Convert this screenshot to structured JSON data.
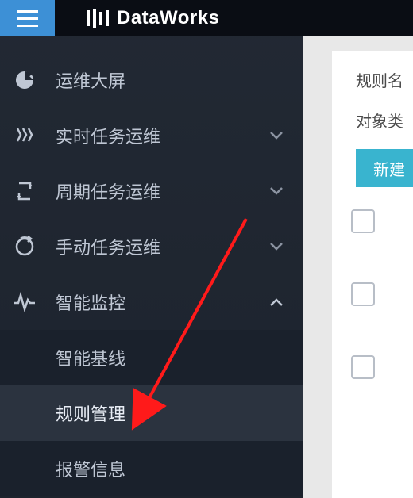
{
  "header": {
    "product": "DataWorks"
  },
  "sidebar": {
    "items": [
      {
        "label": "运维大屏",
        "expandable": false
      },
      {
        "label": "实时任务运维",
        "expandable": true,
        "expanded": false
      },
      {
        "label": "周期任务运维",
        "expandable": true,
        "expanded": false
      },
      {
        "label": "手动任务运维",
        "expandable": true,
        "expanded": false
      },
      {
        "label": "智能监控",
        "expandable": true,
        "expanded": true,
        "children": [
          {
            "label": "智能基线",
            "active": false
          },
          {
            "label": "规则管理",
            "active": true
          },
          {
            "label": "报警信息",
            "active": false
          }
        ]
      }
    ]
  },
  "content": {
    "filter1": "规则名",
    "filter2": "对象类",
    "createBtn": "新建"
  }
}
